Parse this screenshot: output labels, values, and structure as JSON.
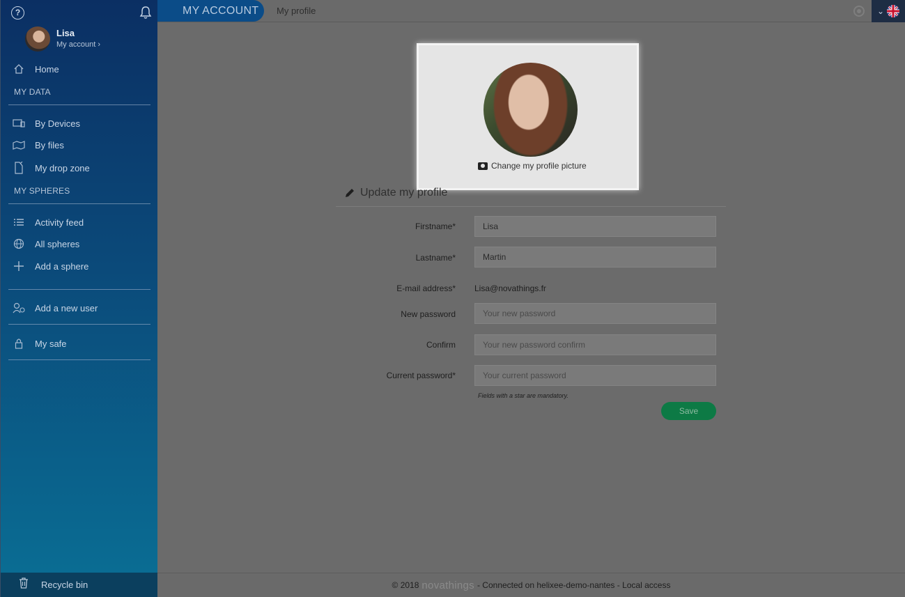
{
  "sidebar": {
    "user": {
      "name": "Lisa",
      "account_link": "My account"
    },
    "home": "Home",
    "section_my_data": "MY DATA",
    "by_devices": "By Devices",
    "by_files": "By files",
    "drop_zone": "My drop zone",
    "section_my_spheres": "MY SPHERES",
    "activity_feed": "Activity feed",
    "all_spheres": "All spheres",
    "add_sphere": "Add a sphere",
    "add_user": "Add a new user",
    "my_safe": "My safe",
    "recycle_bin": "Recycle bin"
  },
  "topbar": {
    "section_title": "MY ACCOUNT",
    "breadcrumb": "My profile"
  },
  "profile_picture": {
    "change_label": "Change my profile picture"
  },
  "form": {
    "title": "Update my profile",
    "firstname_label": "Firstname*",
    "firstname_value": "Lisa",
    "lastname_label": "Lastname*",
    "lastname_value": "Martin",
    "email_label": "E-mail address*",
    "email_value": "Lisa@novathings.fr",
    "new_password_label": "New password",
    "new_password_placeholder": "Your new password",
    "confirm_label": "Confirm",
    "confirm_placeholder": "Your new password confirm",
    "current_password_label": "Current password*",
    "current_password_placeholder": "Your current password",
    "mandatory_note": "Fields with a star are mandatory.",
    "save_label": "Save"
  },
  "footer": {
    "copyright": "© 2018",
    "brand": "novathings",
    "status": "- Connected on helixee-demo-nantes - Local access"
  },
  "colors": {
    "sidebar_top": "#0b2f63",
    "sidebar_bottom": "#0a6f95",
    "accent": "#0b4c88",
    "save_green": "#0d7a45",
    "overlay_gray": "#6b6b6b"
  }
}
